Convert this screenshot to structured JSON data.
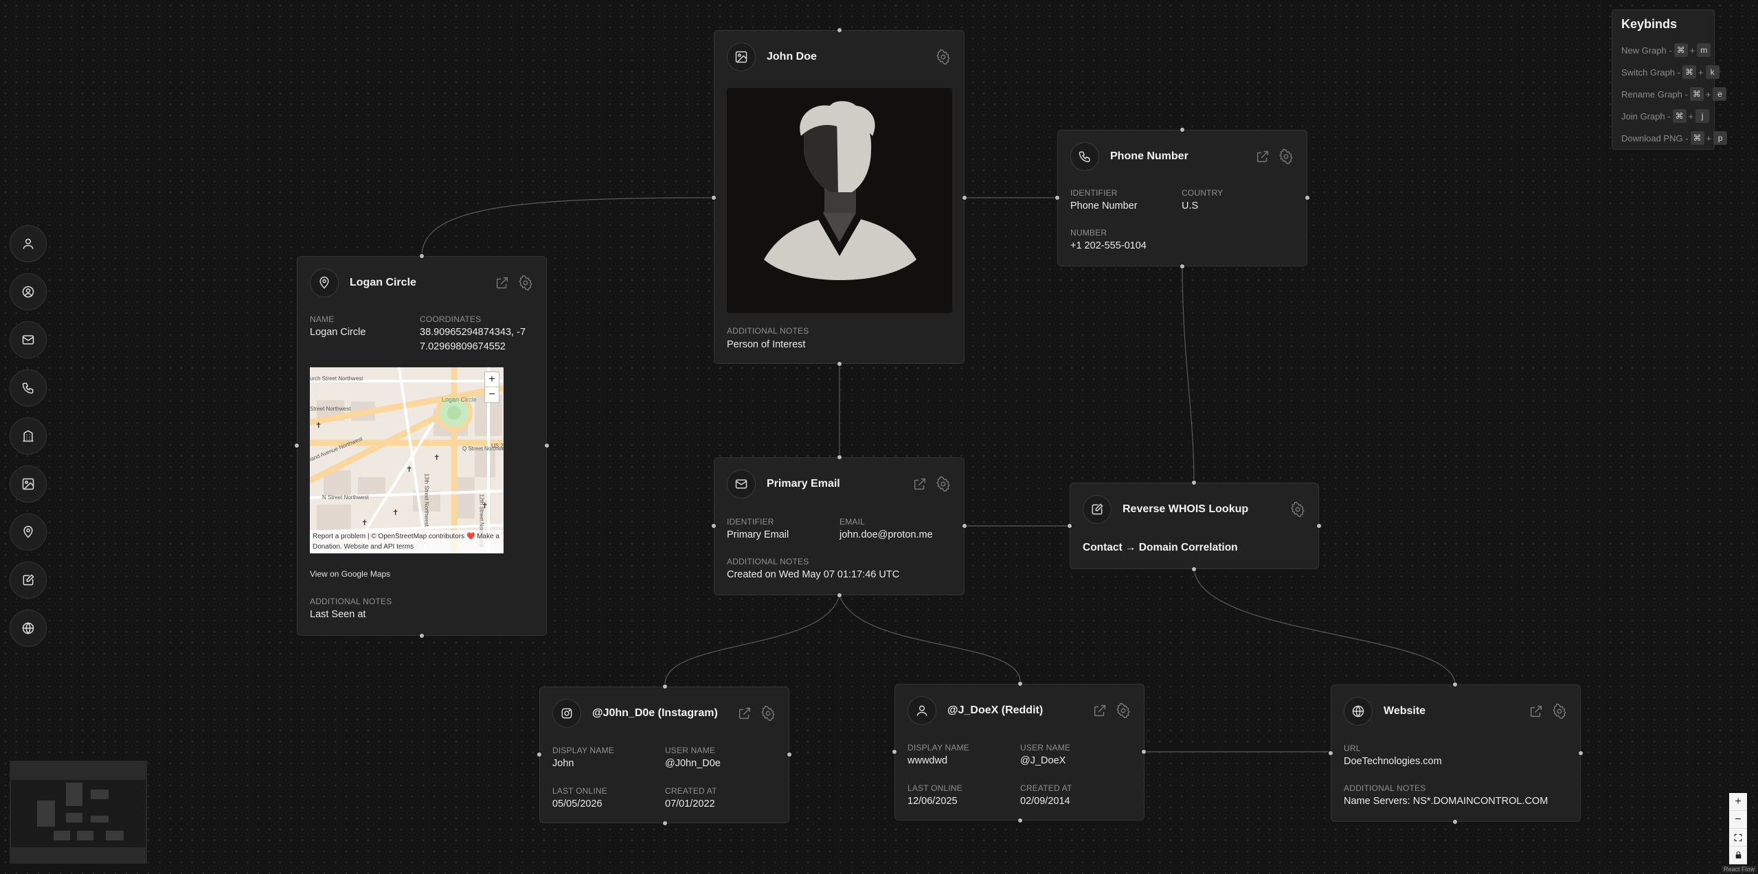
{
  "sidebar": {
    "items": [
      {
        "icon": "person-icon",
        "label": "person"
      },
      {
        "icon": "user-circle-icon",
        "label": "username"
      },
      {
        "icon": "mail-icon",
        "label": "email"
      },
      {
        "icon": "phone-icon",
        "label": "phone"
      },
      {
        "icon": "building-icon",
        "label": "organization"
      },
      {
        "icon": "image-icon",
        "label": "image"
      },
      {
        "icon": "map-pin-icon",
        "label": "location"
      },
      {
        "icon": "note-edit-icon",
        "label": "note"
      },
      {
        "icon": "globe-icon",
        "label": "website"
      }
    ]
  },
  "keybinds": {
    "title": "Keybinds",
    "rows": [
      {
        "label": "New Graph -",
        "mod": "⌘",
        "plus": "+",
        "key": "m"
      },
      {
        "label": "Switch Graph -",
        "mod": "⌘",
        "plus": "+",
        "key": "k"
      },
      {
        "label": "Rename Graph -",
        "mod": "⌘",
        "plus": "+",
        "key": "e"
      },
      {
        "label": "Join Graph -",
        "mod": "⌘",
        "plus": "+",
        "key": "j"
      },
      {
        "label": "Download PNG -",
        "mod": "⌘",
        "plus": "+",
        "key": "p"
      }
    ]
  },
  "nodes": {
    "john_doe": {
      "title": "John Doe",
      "notes_label": "ADDITIONAL NOTES",
      "notes": "Person of Interest"
    },
    "phone": {
      "title": "Phone Number",
      "identifier_label": "IDENTIFIER",
      "identifier": "Phone Number",
      "country_label": "COUNTRY",
      "country": "U.S",
      "number_label": "NUMBER",
      "number": "+1 202-555-0104"
    },
    "logan": {
      "title": "Logan Circle",
      "name_label": "NAME",
      "name": "Logan Circle",
      "coords_label": "COORDINATES",
      "coords_line1": "38.90965294874343, -7",
      "coords_line2": "7.02969809674552",
      "map_link": "View on Google Maps",
      "notes_label": "ADDITIONAL NOTES",
      "notes": "Last Seen at",
      "map": {
        "streets": [
          "urch Street Northwest",
          "Street Northwest",
          "land Avenue Northwest",
          "Q Street Northwest",
          "N Street Northwest",
          "13th Street Northwest",
          "12th Street Northwest",
          "US 2"
        ],
        "circle_label": "Logan Circle",
        "zoom_in": "+",
        "zoom_out": "−",
        "attribution_line1": "Report a problem | © OpenStreetMap contributors ❤️ Make a",
        "attribution_line2": "Donation. Website and API terms"
      }
    },
    "email": {
      "title": "Primary Email",
      "identifier_label": "IDENTIFIER",
      "identifier": "Primary Email",
      "email_label": "EMAIL",
      "email": "john.doe@proton.me",
      "notes_label": "ADDITIONAL NOTES",
      "notes": "Created on Wed May 07 01:17:46 UTC"
    },
    "whois": {
      "title": "Reverse WHOIS Lookup",
      "subtitle": "Contact → Domain Correlation"
    },
    "instagram": {
      "title": "@J0hn_D0e (Instagram)",
      "display_label": "DISPLAY NAME",
      "display": "John",
      "user_label": "USER NAME",
      "user": "@J0hn_D0e",
      "last_label": "LAST ONLINE",
      "last": "05/05/2026",
      "created_label": "CREATED AT",
      "created": "07/01/2022"
    },
    "reddit": {
      "title": "@J_DoeX (Reddit)",
      "display_label": "DISPLAY NAME",
      "display": "wwwdwd",
      "user_label": "USER NAME",
      "user": "@J_DoeX",
      "last_label": "LAST ONLINE",
      "last": "12/06/2025",
      "created_label": "CREATED AT",
      "created": "02/09/2014"
    },
    "website": {
      "title": "Website",
      "url_label": "URL",
      "url": "DoeTechnologies.com",
      "notes_label": "ADDITIONAL NOTES",
      "notes": "Name Servers: NS*.DOMAINCONTROL.COM"
    }
  },
  "controls": {
    "zoom_in": "+",
    "zoom_out": "−",
    "fit": "⛶",
    "lock": "🔒"
  },
  "attribution": "React Flow"
}
